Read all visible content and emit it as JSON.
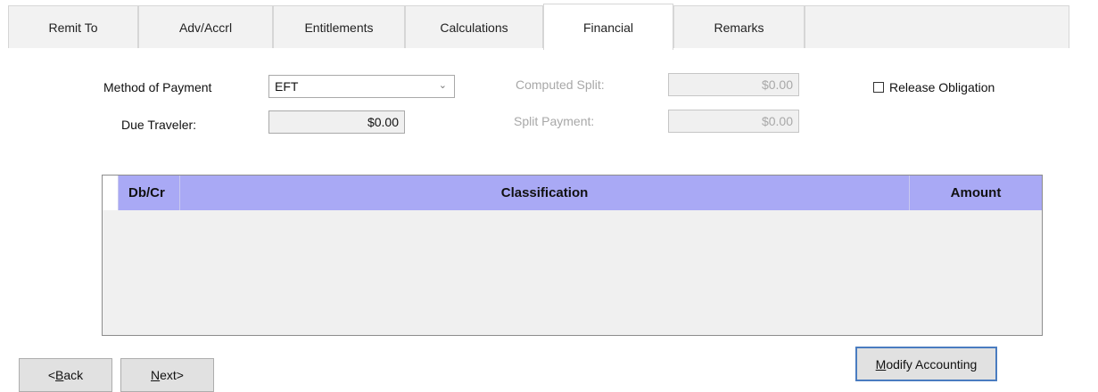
{
  "tabs": [
    "Remit To",
    "Adv/Accrl",
    "Entitlements",
    "Calculations",
    "Financial",
    "Remarks"
  ],
  "active_tab": "Financial",
  "form": {
    "method_of_payment_label": "Method of Payment",
    "method_of_payment_value": "EFT",
    "due_traveler_label": "Due Traveler:",
    "due_traveler_value": "$0.00",
    "computed_split_label": "Computed Split:",
    "computed_split_value": "$0.00",
    "split_payment_label": "Split Payment:",
    "split_payment_value": "$0.00",
    "release_obligation_label": "Release Obligation",
    "release_obligation_checked": false
  },
  "grid": {
    "columns": [
      "Db/Cr",
      "Classification",
      "Amount"
    ],
    "rows": []
  },
  "buttons": {
    "back_prefix": "<",
    "back_mnemonic": "B",
    "back_rest": "ack",
    "next_mnemonic": "N",
    "next_rest": "ext>",
    "modify_mnemonic": "M",
    "modify_rest": "odify Accounting"
  }
}
